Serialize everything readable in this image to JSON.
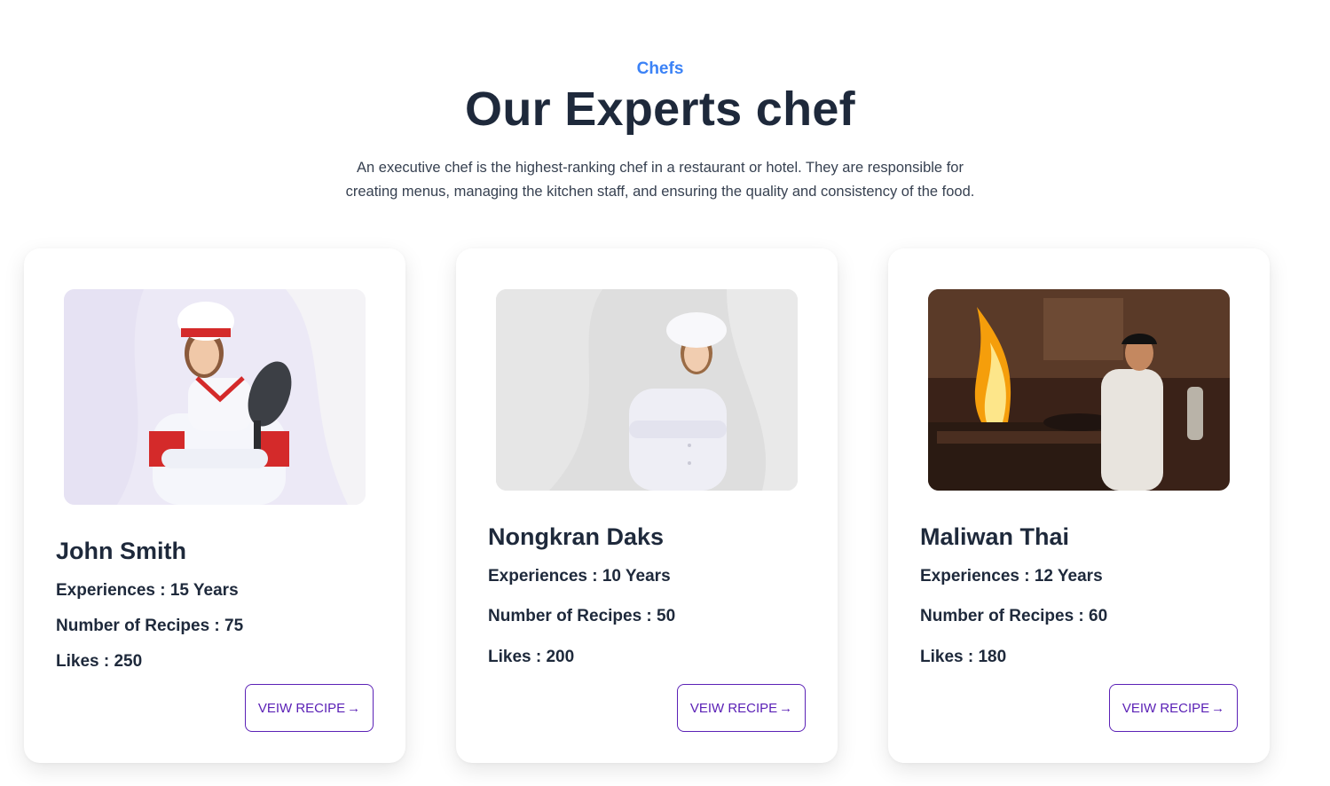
{
  "header": {
    "eyebrow": "Chefs",
    "title": "Our Experts chef",
    "description": "An executive chef is the highest-ranking chef in a restaurant or hotel. They are responsible for creating menus, managing the kitchen staff, and ensuring the quality and consistency of the food."
  },
  "accent_colors": {
    "eyebrow": "#3b82f6",
    "button": "#5b21b6",
    "heading": "#1e293b"
  },
  "chefs": [
    {
      "name": "John Smith",
      "experience": "Experiences : 15 Years",
      "recipes": "Number of Recipes : 75",
      "likes": "Likes : 250",
      "button_label": "VEIW RECIPE",
      "button_icon": "arrow-right-icon"
    },
    {
      "name": "Nongkran Daks",
      "experience": "Experiences : 10 Years",
      "recipes": "Number of Recipes : 50",
      "likes": "Likes : 200",
      "button_label": "VEIW RECIPE",
      "button_icon": "arrow-right-icon"
    },
    {
      "name": "Maliwan Thai",
      "experience": "Experiences : 12 Years",
      "recipes": "Number of Recipes : 60",
      "likes": "Likes : 180",
      "button_label": "VEIW RECIPE",
      "button_icon": "arrow-right-icon"
    }
  ]
}
